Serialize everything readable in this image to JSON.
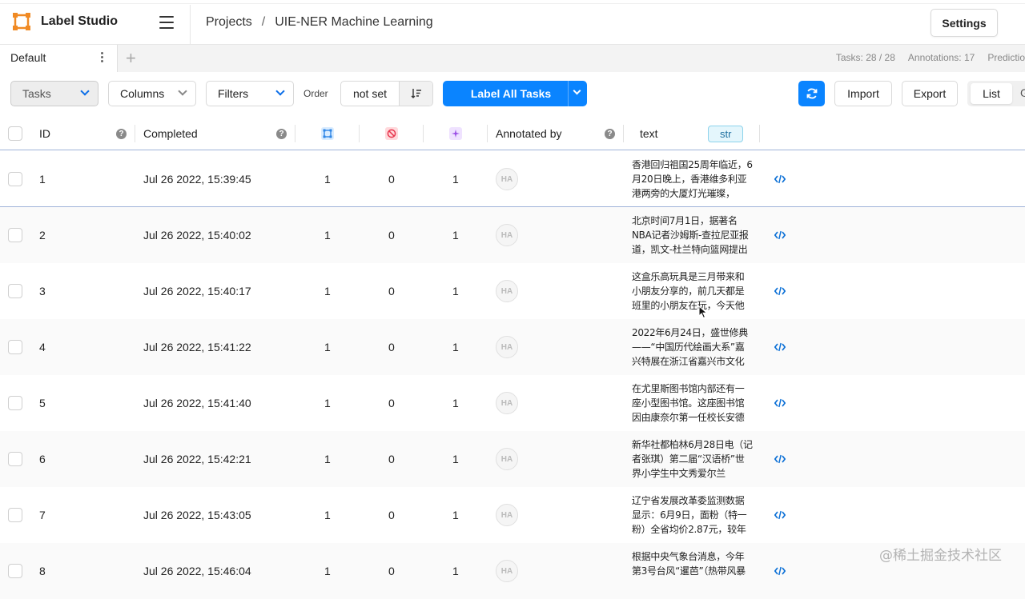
{
  "app": {
    "brand": "Label Studio"
  },
  "breadcrumb": {
    "projects": "Projects",
    "separator": "/",
    "project": "UIE-NER Machine Learning"
  },
  "header": {
    "settings_label": "Settings"
  },
  "tabs": {
    "items": [
      {
        "label": "Default"
      }
    ],
    "add_label": "+"
  },
  "stats": {
    "tasks": "Tasks: 28 / 28",
    "annotations": "Annotations: 17",
    "predictions": "Predictio"
  },
  "toolbar": {
    "tasks_label": "Tasks",
    "columns_label": "Columns",
    "filters_label": "Filters",
    "order_label": "Order",
    "order_value": "not set",
    "label_all": "Label All Tasks",
    "import_label": "Import",
    "export_label": "Export",
    "view_list": "List",
    "view_grid": "G"
  },
  "table": {
    "headers": {
      "id": "ID",
      "completed": "Completed",
      "annotated_by": "Annotated by",
      "text": "text",
      "text_type": "str",
      "help": "?"
    },
    "rows": [
      {
        "id": "1",
        "completed": "Jul 26 2022, 15:39:45",
        "total": "1",
        "cancelled": "0",
        "predictions": "1",
        "annotator": "HA",
        "text": "香港回归祖国25周年临近，6月20日晚上，香港维多利亚港两旁的大厦灯光璀璨，"
      },
      {
        "id": "2",
        "completed": "Jul 26 2022, 15:40:02",
        "total": "1",
        "cancelled": "0",
        "predictions": "1",
        "annotator": "HA",
        "text": "北京时间7月1日，据著名NBA记者沙姆斯-查拉尼亚报道，凯文-杜兰特向篮网提出"
      },
      {
        "id": "3",
        "completed": "Jul 26 2022, 15:40:17",
        "total": "1",
        "cancelled": "0",
        "predictions": "1",
        "annotator": "HA",
        "text": "这盒乐高玩具是三月带来和小朋友分享的，前几天都是班里的小朋友在玩，今天他"
      },
      {
        "id": "4",
        "completed": "Jul 26 2022, 15:41:22",
        "total": "1",
        "cancelled": "0",
        "predictions": "1",
        "annotator": "HA",
        "text": "2022年6月24日，盛世修典——“中国历代绘画大系”嘉兴特展在浙江省嘉兴市文化艺"
      },
      {
        "id": "5",
        "completed": "Jul 26 2022, 15:41:40",
        "total": "1",
        "cancelled": "0",
        "predictions": "1",
        "annotator": "HA",
        "text": "在尤里斯图书馆内部还有一座小型图书馆。这座图书馆因由康奈尔第一任校长安德"
      },
      {
        "id": "6",
        "completed": "Jul 26 2022, 15:42:21",
        "total": "1",
        "cancelled": "0",
        "predictions": "1",
        "annotator": "HA",
        "text": "新华社都柏林6月28日电（记者张琪）第二届“汉语桥”世界小学生中文秀爱尔兰"
      },
      {
        "id": "7",
        "completed": "Jul 26 2022, 15:43:05",
        "total": "1",
        "cancelled": "0",
        "predictions": "1",
        "annotator": "HA",
        "text": "辽宁省发展改革委监测数据显示：6月9日，面粉（特一粉）全省均价2.87元，较年"
      },
      {
        "id": "8",
        "completed": "Jul 26 2022, 15:46:04",
        "total": "1",
        "cancelled": "0",
        "predictions": "1",
        "annotator": "HA",
        "text": "根据中央气象台消息，今年第3号台风“暹芭”（热带风暴"
      }
    ]
  },
  "watermark": "@稀土掘金技术社区",
  "colors": {
    "accent": "#0a84ff",
    "row_divider": "#9fb3d9",
    "logo": "#f08a24"
  }
}
